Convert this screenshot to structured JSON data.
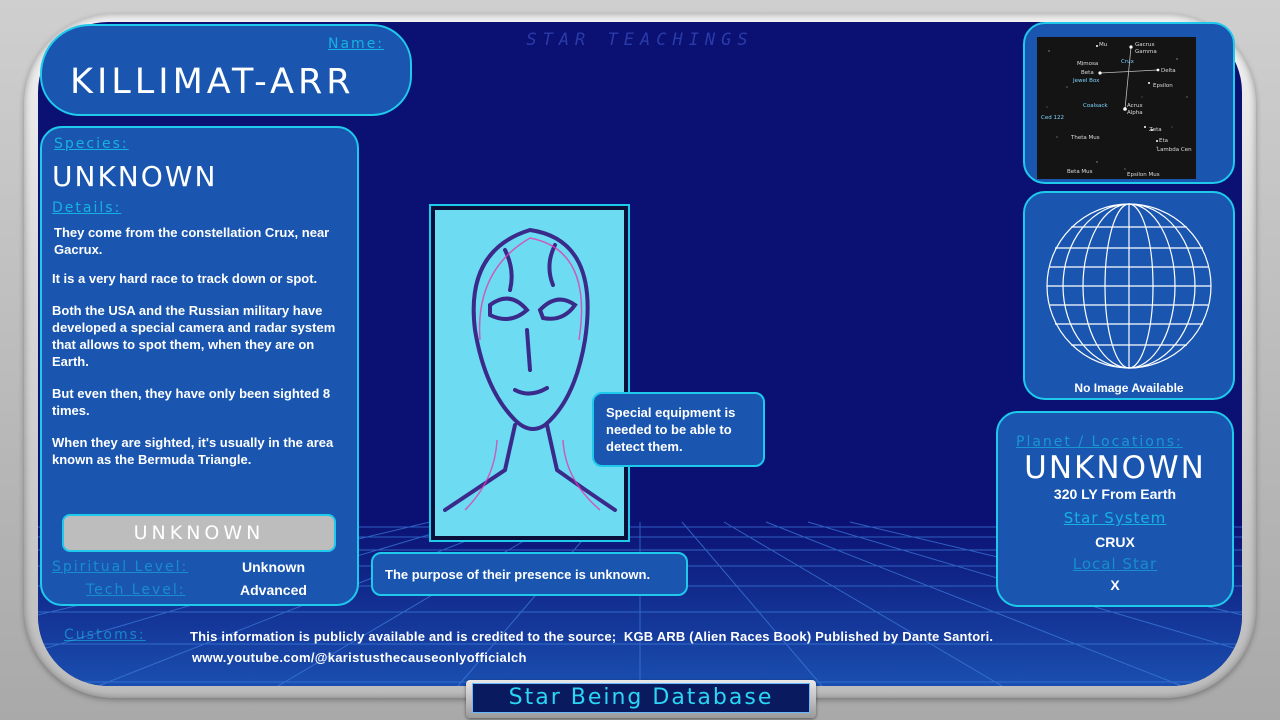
{
  "header": {
    "title": "STAR TEACHINGS"
  },
  "name_panel": {
    "label": "Name:",
    "value": "KILLIMAT-ARR"
  },
  "left_panel": {
    "species_label": "Species:",
    "species_value": "UNKNOWN",
    "details_label": "Details:",
    "paragraphs": [
      "They come from the constellation Crux, near Gacrux.",
      "It is a very hard race to track down or spot.",
      "Both the USA and the Russian military have developed a special camera and radar system that allows to spot them, when they are on Earth.",
      "But even then, they have only been sighted 8 times.",
      "When they are sighted, it's usually in the area known as the Bermuda Triangle."
    ],
    "status_button": "UNKNOWN",
    "spiritual_label": "Spiritual Level:",
    "spiritual_value": "Unknown",
    "tech_label": "Tech Level:",
    "tech_value": "Advanced"
  },
  "center": {
    "callout_equipment": "Special equipment is needed to be able to detect them.",
    "callout_purpose": "The purpose of their presence is unknown."
  },
  "star_map": {
    "labels": [
      "Mu",
      "Gacrux",
      "Gamma",
      "Mimosa",
      "Crux",
      "Beta",
      "Delta",
      "Jewel Box",
      "Epsilon",
      "Coalsack",
      "Acrux",
      "Alpha",
      "Ced 122",
      "Zeta",
      "Theta Mus",
      "Eta",
      "Lambda Cen",
      "Beta Mus",
      "Epsilon Mus"
    ]
  },
  "globe_panel": {
    "caption": "No Image Available"
  },
  "right_panel": {
    "planet_label": "Planet / Locations:",
    "planet_value": "UNKNOWN",
    "distance": "320 LY From Earth",
    "system_label": "Star System",
    "system_value": "CRUX",
    "local_star_label": "Local Star",
    "local_star_value": "X"
  },
  "footer": {
    "customs_label": "Customs:",
    "credit_line": "This information is publicly available and is credited to the source;  KGB ARB (Alien Races Book) Published by Dante Santori.",
    "url": "www.youtube.com/@karistusthecauseonlyofficialch",
    "badge": "Star Being Database"
  },
  "colors": {
    "background": "#0b1173",
    "panel": "#1a56b0",
    "accent": "#1fc9ec",
    "badge_text": "#2bd6f5"
  }
}
